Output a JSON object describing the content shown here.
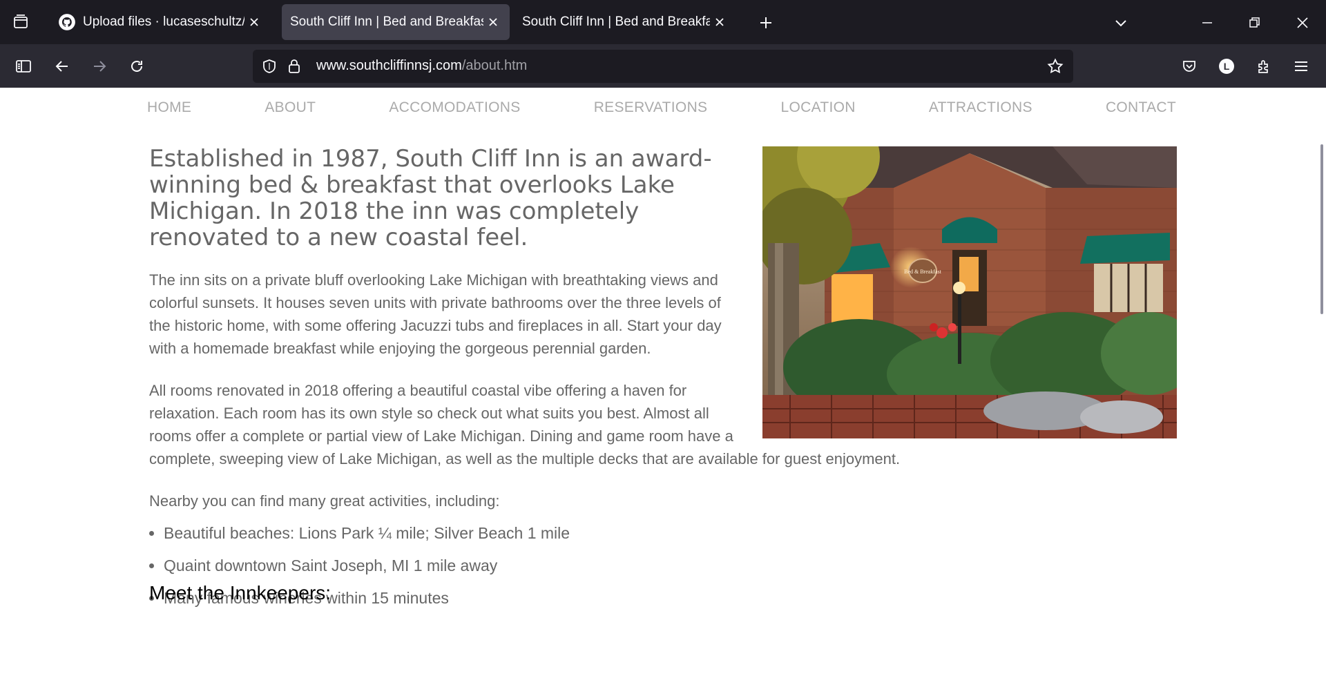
{
  "browser": {
    "tabs": [
      {
        "title": "Upload files · lucaseschultz/HTML",
        "active": false
      },
      {
        "title": "South Cliff Inn | Bed and Breakfast | S",
        "active": true
      },
      {
        "title": "South Cliff Inn | Bed and Breakfast | S",
        "active": false
      }
    ],
    "url_domain": "www.southcliffinnsj.com",
    "url_path": "/about.htm",
    "account_initial": "L"
  },
  "site_nav": [
    "HOME",
    "ABOUT",
    "ACCOMODATIONS",
    "RESERVATIONS",
    "LOCATION",
    "ATTRACTIONS",
    "CONTACT"
  ],
  "content": {
    "lead": "Established in 1987, South Cliff Inn is an award-winning bed & breakfast that overlooks Lake Michigan. In 2018 the inn was completely renovated to a new coastal feel.",
    "paragraph1": "The inn sits on a private bluff overlooking Lake Michigan with breathtaking views and colorful sunsets. It houses seven units with private bathrooms over the three levels of the historic home, with some offering Jacuzzi tubs and fireplaces in all. Start your day with a homemade breakfast while enjoying the gorgeous perennial garden.",
    "paragraph2": "All rooms renovated in 2018 offering a beautiful coastal vibe offering a haven for relaxation. Each room has its own style so check out what suits you best. Almost all rooms offer a complete or partial view of Lake Michigan. Dining and game room have a complete, sweeping view of Lake Michigan, as well as the multiple decks that are available for guest enjoyment.",
    "nearby_intro": "Nearby you can find many great activities, including:",
    "activities": [
      "Beautiful beaches: Lions Park ¼ mile; Silver Beach 1 mile",
      "Quaint downtown Saint Joseph, MI 1 mile away",
      "Many famous wineries within 15 minutes"
    ],
    "innkeepers_heading": "Meet the Innkeepers:",
    "sign_text": "Bed & Breakfast"
  }
}
